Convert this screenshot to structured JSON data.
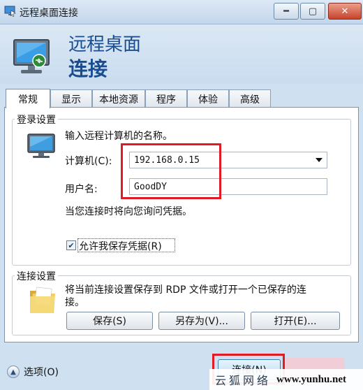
{
  "window": {
    "title": "远程桌面连接",
    "min_symbol": "━",
    "max_symbol": "▢",
    "close_symbol": "✕"
  },
  "header": {
    "line1": "远程桌面",
    "line2": "连接"
  },
  "tabs": [
    {
      "label": "常规",
      "active": true
    },
    {
      "label": "显示"
    },
    {
      "label": "本地资源"
    },
    {
      "label": "程序"
    },
    {
      "label": "体验"
    },
    {
      "label": "高级"
    }
  ],
  "login": {
    "group_label": "登录设置",
    "instruction": "输入远程计算机的名称。",
    "computer_label": "计算机(C):",
    "computer_value": "192.168.0.15",
    "username_label": "用户名:",
    "username_value": "GoodDY",
    "credentials_note": "当您连接时将向您询问凭据。",
    "save_credentials_label": "允许我保存凭据(R)",
    "save_credentials_checked": true
  },
  "connection": {
    "group_label": "连接设置",
    "description_line1": "将当前连接设置保存到 RDP 文件或打开一个已保存的连",
    "description_line2": "接。",
    "save_button": "保存(S)",
    "save_as_button": "另存为(V)...",
    "open_button": "打开(E)..."
  },
  "footer": {
    "options_label": "选项(O)",
    "connect_button": "连接(N)"
  },
  "watermark": {
    "text": "云狐网络",
    "url": "www.yunhu.net"
  },
  "colors": {
    "annotation": "#e01b24",
    "title_blue": "#1a4d8f"
  }
}
